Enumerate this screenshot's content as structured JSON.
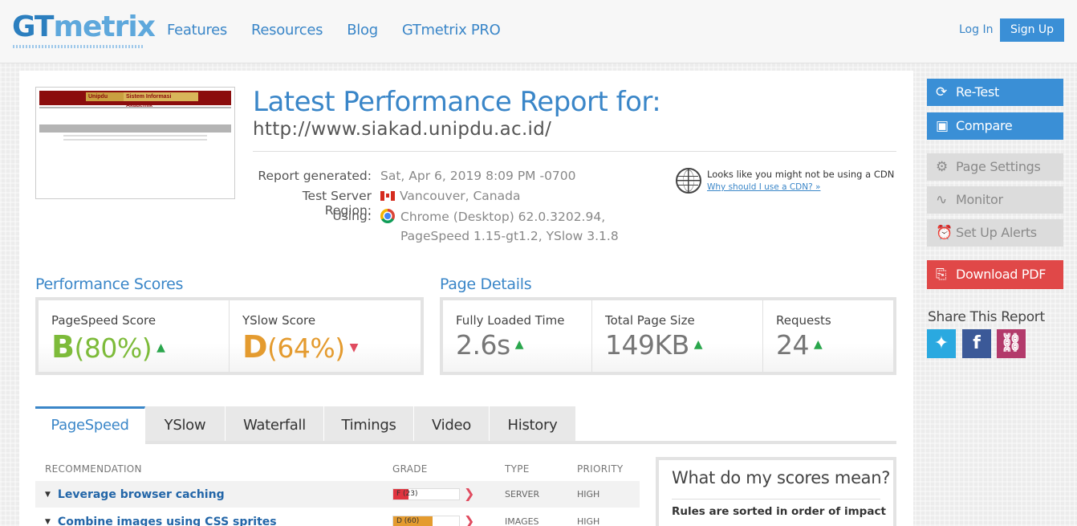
{
  "header": {
    "logo_gt": "GT",
    "logo_metrix": "metrix",
    "nav": [
      "Features",
      "Resources",
      "Blog",
      "GTmetrix PRO"
    ],
    "login": "Log In",
    "signup": "Sign Up"
  },
  "report": {
    "title": "Latest Performance Report for:",
    "url": "http://www.siakad.unipdu.ac.id/",
    "thumbnail_logo": "Unipdu",
    "thumbnail_title": "Sistem Informasi Akademik",
    "meta": [
      {
        "label": "Report generated:",
        "value": "Sat, Apr 6, 2019 8:09 PM -0700"
      },
      {
        "label": "Test Server Region:",
        "value": "Vancouver, Canada"
      },
      {
        "label": "Using:",
        "value": "Chrome (Desktop) 62.0.3202.94,"
      },
      {
        "label": "",
        "value": "PageSpeed 1.15-gt1.2, YSlow 3.1.8"
      }
    ],
    "cdn_text": "Looks like you might not be using a CDN",
    "cdn_link": "Why should I use a CDN? »"
  },
  "performance": {
    "title": "Performance Scores",
    "pagespeed_label": "PageSpeed Score",
    "pagespeed_grade": "B",
    "pagespeed_pct": "(80%)",
    "yslow_label": "YSlow Score",
    "yslow_grade": "D",
    "yslow_pct": "(64%)",
    "colors": {
      "pagespeed": "#7dbb3a",
      "yslow": "#e49b2f"
    }
  },
  "details": {
    "title": "Page Details",
    "items": [
      {
        "label": "Fully Loaded Time",
        "value": "2.6s"
      },
      {
        "label": "Total Page Size",
        "value": "149KB"
      },
      {
        "label": "Requests",
        "value": "24"
      }
    ]
  },
  "tabs": [
    "PageSpeed",
    "YSlow",
    "Waterfall",
    "Timings",
    "Video",
    "History"
  ],
  "recommendations": {
    "headers": {
      "recommendation": "RECOMMENDATION",
      "grade": "GRADE",
      "type": "TYPE",
      "priority": "PRIORITY"
    },
    "rows": [
      {
        "name": "Leverage browser caching",
        "grade": "F (23)",
        "score": 23,
        "color": "#e0343f",
        "type": "SERVER",
        "priority": "HIGH"
      },
      {
        "name": "Combine images using CSS sprites",
        "grade": "D (60)",
        "score": 60,
        "color": "#e49b2f",
        "type": "IMAGES",
        "priority": "HIGH"
      }
    ]
  },
  "scores_info": {
    "title": "What do my scores mean?",
    "desc": "Rules are sorted in order of impact"
  },
  "sidebar": {
    "retest": "Re-Test",
    "compare": "Compare",
    "page_settings": "Page Settings",
    "monitor": "Monitor",
    "alerts": "Set Up Alerts",
    "download": "Download PDF",
    "share_title": "Share This Report"
  }
}
